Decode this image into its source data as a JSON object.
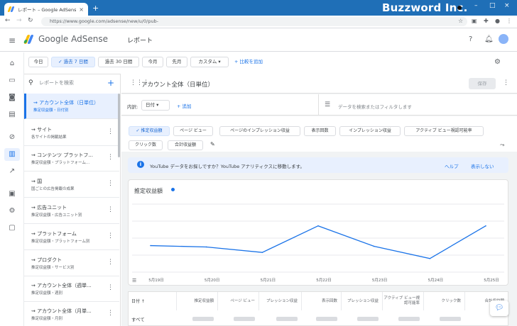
{
  "browser": {
    "tab_title": "レポート – Google AdSense",
    "tab_close": "×",
    "new_tab": "+",
    "brand": "Buzzword Inc.",
    "url": "https://www.google.com/adsense/new/u/0/pub-",
    "win_min": "–",
    "win_max": "□",
    "win_close": "×"
  },
  "header": {
    "product_google": "Google",
    "product_adsense": "AdSense",
    "page_title": "レポート"
  },
  "date_chips": [
    {
      "label": "今日",
      "active": false
    },
    {
      "label": "過去 7 日間",
      "active": true
    },
    {
      "label": "過去 30 日間",
      "active": false
    },
    {
      "label": "今月",
      "active": false
    },
    {
      "label": "先月",
      "active": false
    },
    {
      "label": "カスタム",
      "active": false
    }
  ],
  "compare_label": "比較を追加",
  "list": {
    "search_placeholder": "レポートを検索",
    "items": [
      {
        "title": "アカウント全体（日単位）",
        "sub": "推定収益額・日付別"
      },
      {
        "title": "サイト",
        "sub": "各サイトの掲載結果"
      },
      {
        "title": "コンテンツ プラットフ...",
        "sub": "推定収益額・プラットフォーム..."
      },
      {
        "title": "国",
        "sub": "国ごとの広告掲載の成果"
      },
      {
        "title": "広告ユニット",
        "sub": "推定収益額・広告ユニット別"
      },
      {
        "title": "プラットフォーム",
        "sub": "推定収益額・プラットフォーム別"
      },
      {
        "title": "プロダクト",
        "sub": "推定収益額・サービス別"
      },
      {
        "title": "アカウント全体（週単...",
        "sub": "推定収益額・週別"
      },
      {
        "title": "アカウント全体（月単...",
        "sub": "推定収益額・月別"
      }
    ]
  },
  "report": {
    "name": "アカウント全体（日単位）",
    "save": "保存",
    "dim_label": "内訳:",
    "dim_value": "日付",
    "dim_add": "追加",
    "filter_placeholder": "データを検索またはフィルタします"
  },
  "metrics": [
    {
      "label": "推定収益額",
      "on": true
    },
    {
      "label": "ページ ビュー",
      "on": false
    },
    {
      "label": "ページのインプレッション収益",
      "on": false
    },
    {
      "label": "表示回数",
      "on": false
    },
    {
      "label": "インプレッション収益",
      "on": false
    },
    {
      "label": "アクティブ ビュー視認可能率",
      "on": false
    },
    {
      "label": "クリック数",
      "on": false
    },
    {
      "label": "合計収益額",
      "on": false
    }
  ],
  "banner": {
    "text": "YouTube データをお探しですか？YouTube アナリティクスに移動します。",
    "help": "ヘルプ",
    "hide": "表示しない"
  },
  "chart_data": {
    "type": "line",
    "title": "推定収益額",
    "categories": [
      "5月19日",
      "5月20日",
      "5月21日",
      "5月22日",
      "5月23日",
      "5月24日",
      "5月25日"
    ],
    "series": [
      {
        "name": "推定収益額",
        "values": [
          0.39,
          0.37,
          0.29,
          0.68,
          0.38,
          0.2,
          0.68
        ]
      }
    ],
    "ylim": [
      0,
      1
    ],
    "grid": true,
    "colors": {
      "line": "#1a73e8",
      "grid": "#e8eaed"
    }
  },
  "table": {
    "headers": [
      "日付 ↑",
      "推定収益額",
      "ページ ビュー",
      "プレッション収益",
      "表示回数",
      "プレッション収益",
      "アクティブ ビュー視認可能率",
      "クリック数",
      "合計収益額"
    ],
    "first_row_label": "すべて"
  }
}
